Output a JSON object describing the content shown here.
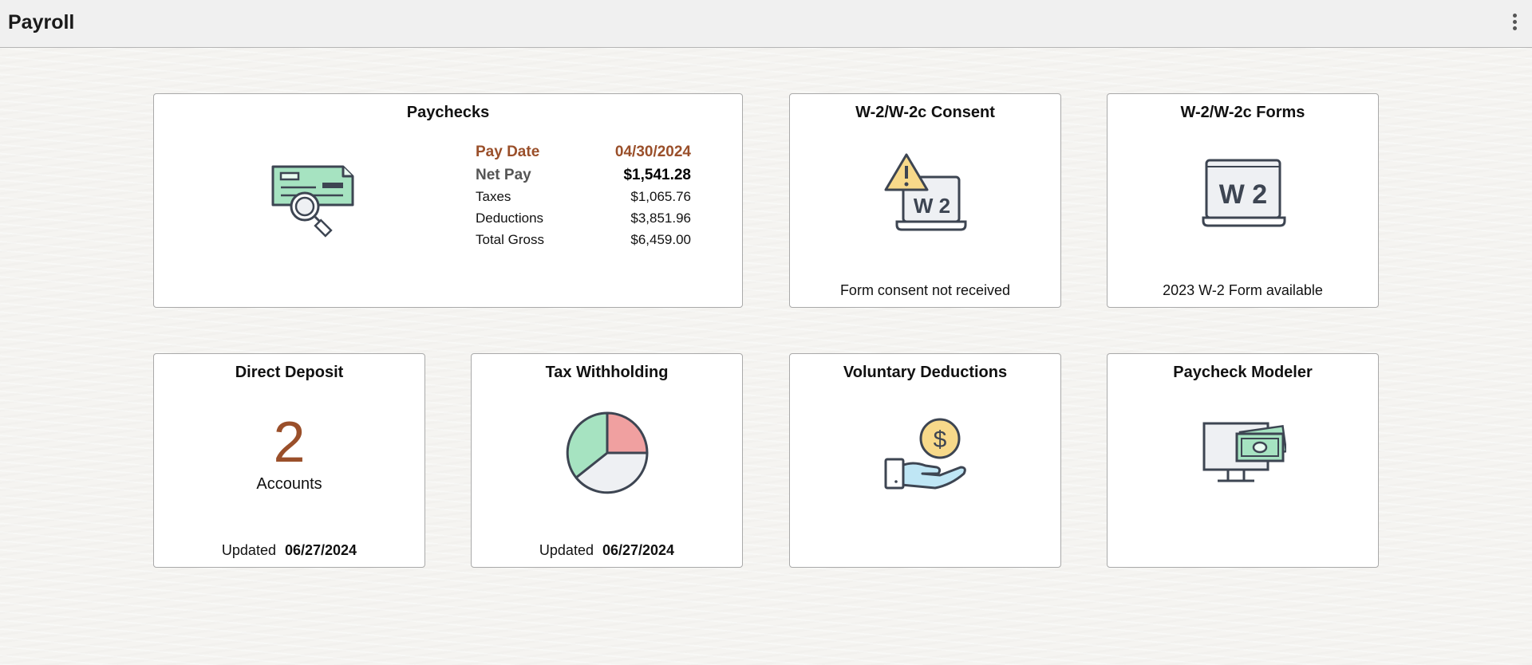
{
  "header": {
    "title": "Payroll",
    "menu_icon": "kebab-menu-icon"
  },
  "colors": {
    "accent": "#9a4f2a",
    "check_green": "#a6e3c1",
    "pie_red": "#f0a0a0",
    "pie_green": "#a6e3c1",
    "coin_yellow": "#f7d98a",
    "hand_blue": "#bfe6f5"
  },
  "tiles": {
    "paychecks": {
      "title": "Paychecks",
      "icon": "check-magnifier-icon",
      "pay_date_label": "Pay Date",
      "pay_date": "04/30/2024",
      "net_pay_label": "Net Pay",
      "net_pay": "$1,541.28",
      "rows": [
        {
          "label": "Taxes",
          "value": "$1,065.76"
        },
        {
          "label": "Deductions",
          "value": "$3,851.96"
        },
        {
          "label": "Total Gross",
          "value": "$6,459.00"
        }
      ]
    },
    "w2_consent": {
      "title": "W-2/W-2c Consent",
      "icon": "warning-laptop-w2-icon",
      "icon_text": "W 2",
      "footer": "Form consent not received"
    },
    "w2_forms": {
      "title": "W-2/W-2c Forms",
      "icon": "laptop-w2-icon",
      "icon_text": "W 2",
      "footer": "2023 W-2 Form available"
    },
    "direct_deposit": {
      "title": "Direct Deposit",
      "count": "2",
      "count_label": "Accounts",
      "updated_label": "Updated",
      "updated_date": "06/27/2024"
    },
    "tax_withholding": {
      "title": "Tax Withholding",
      "icon": "pie-chart-icon",
      "updated_label": "Updated",
      "updated_date": "06/27/2024"
    },
    "voluntary_deductions": {
      "title": "Voluntary Deductions",
      "icon": "hand-coin-icon"
    },
    "paycheck_modeler": {
      "title": "Paycheck Modeler",
      "icon": "monitor-money-icon"
    }
  }
}
